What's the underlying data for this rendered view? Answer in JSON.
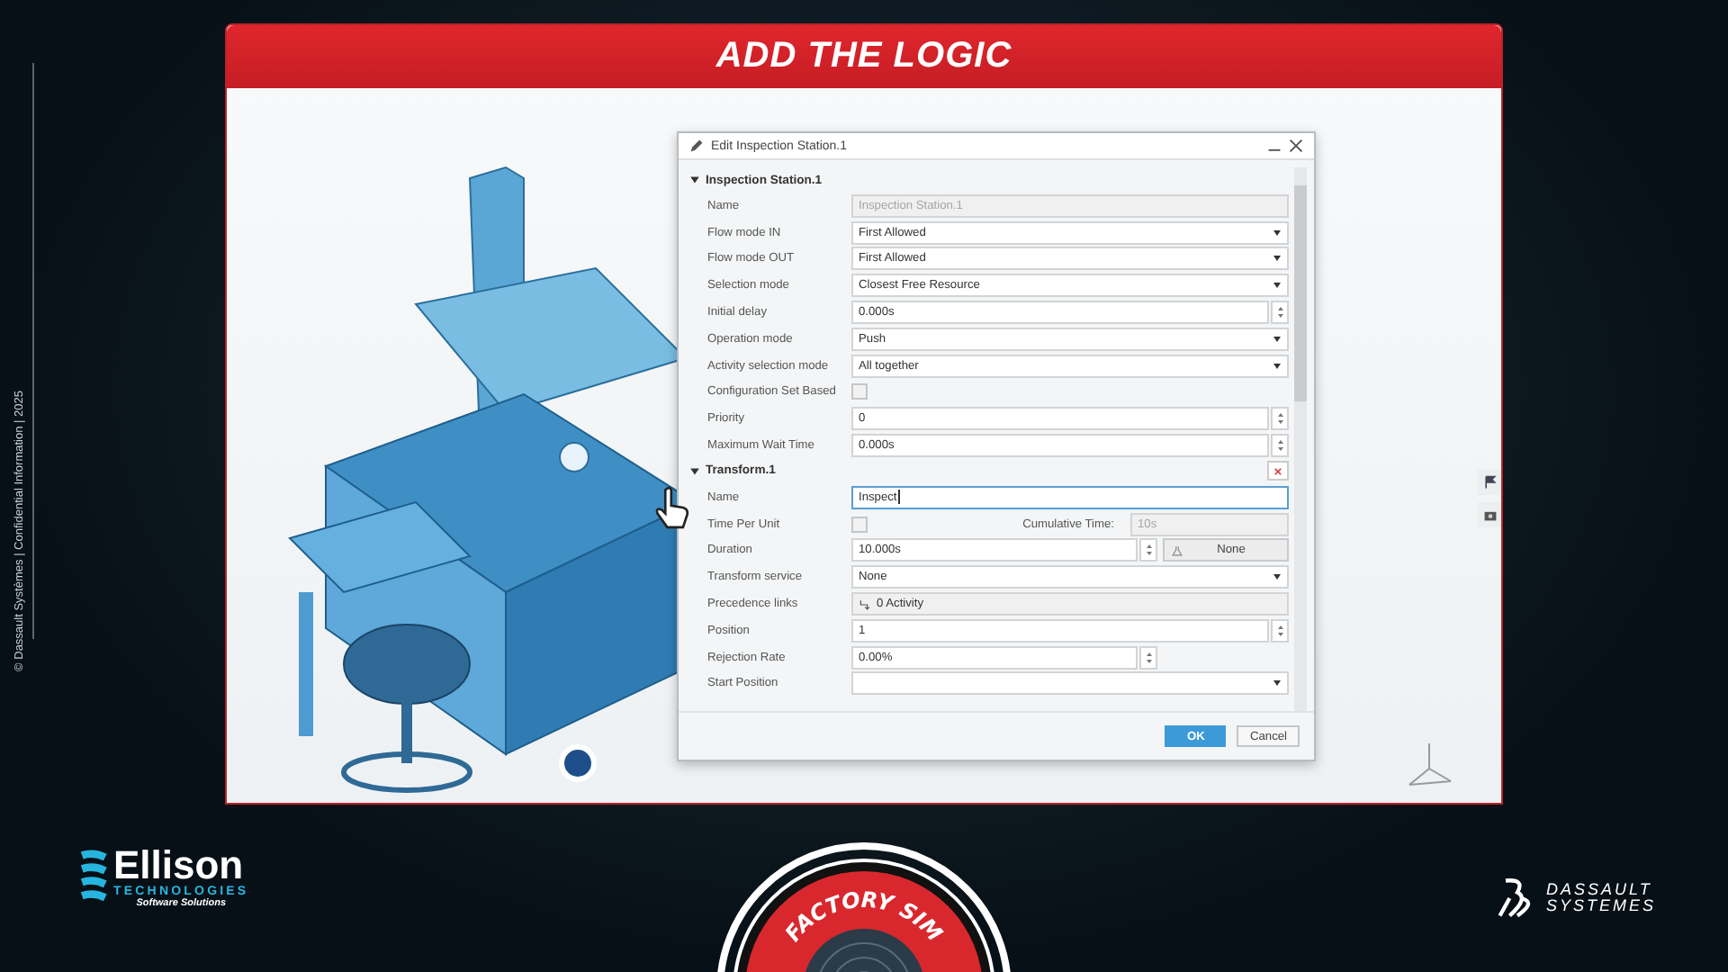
{
  "side_note": "© Dassault Systèmes | Confidential Information | 2025",
  "slide": {
    "title": "ADD THE LOGIC"
  },
  "dialog": {
    "title": "Edit Inspection Station.1",
    "sections": [
      {
        "title": "Inspection Station.1",
        "expanded": true,
        "removable": false,
        "rows": [
          {
            "kind": "text",
            "label": "Name",
            "value": "Inspection Station.1",
            "disabled": true
          },
          {
            "kind": "dropdown",
            "label": "Flow mode IN",
            "value": "First Allowed"
          },
          {
            "kind": "dropdown",
            "label": "Flow mode OUT",
            "value": "First Allowed"
          },
          {
            "kind": "dropdown",
            "label": "Selection mode",
            "value": "Closest Free Resource"
          },
          {
            "kind": "spinner",
            "label": "Initial delay",
            "value": "0.000s"
          },
          {
            "kind": "dropdown",
            "label": "Operation mode",
            "value": "Push"
          },
          {
            "kind": "dropdown",
            "label": "Activity selection mode",
            "value": "All together"
          },
          {
            "kind": "checkbox",
            "label": "Configuration Set Based",
            "checked": false
          },
          {
            "kind": "spinner",
            "label": "Priority",
            "value": "0"
          },
          {
            "kind": "spinner",
            "label": "Maximum Wait Time",
            "value": "0.000s"
          }
        ]
      },
      {
        "title": "Transform.1",
        "expanded": true,
        "removable": true,
        "rows": [
          {
            "kind": "text",
            "label": "Name",
            "value": "Inspect",
            "disabled": false,
            "focused": true
          },
          {
            "kind": "checkbox_pair",
            "label": "Time Per Unit",
            "checked": false,
            "label_2": "Cumulative Time:",
            "value_2": "10s"
          },
          {
            "kind": "spinner_button",
            "label": "Duration",
            "value": "10.000s",
            "button": "None"
          },
          {
            "kind": "dropdown",
            "label": "Transform service",
            "value": "None"
          },
          {
            "kind": "link",
            "label": "Precedence links",
            "value": "0 Activity"
          },
          {
            "kind": "spinner",
            "label": "Position",
            "value": "1"
          },
          {
            "kind": "spinner_short",
            "label": "Rejection Rate",
            "value": "0.00%"
          },
          {
            "kind": "dropdown",
            "label": "Start Position",
            "value": ""
          }
        ]
      }
    ],
    "buttons": [
      {
        "label": "OK",
        "primary": true
      },
      {
        "label": "Cancel",
        "primary": false
      }
    ]
  },
  "logos": {
    "left": {
      "name": "Ellison",
      "sub": "TECHNOLOGIES",
      "tagline": "Software Solutions"
    },
    "center": {
      "name": "FACTORY SIM"
    },
    "right": {
      "line_1": "DASSAULT",
      "line_2": "SYSTEMES"
    }
  }
}
